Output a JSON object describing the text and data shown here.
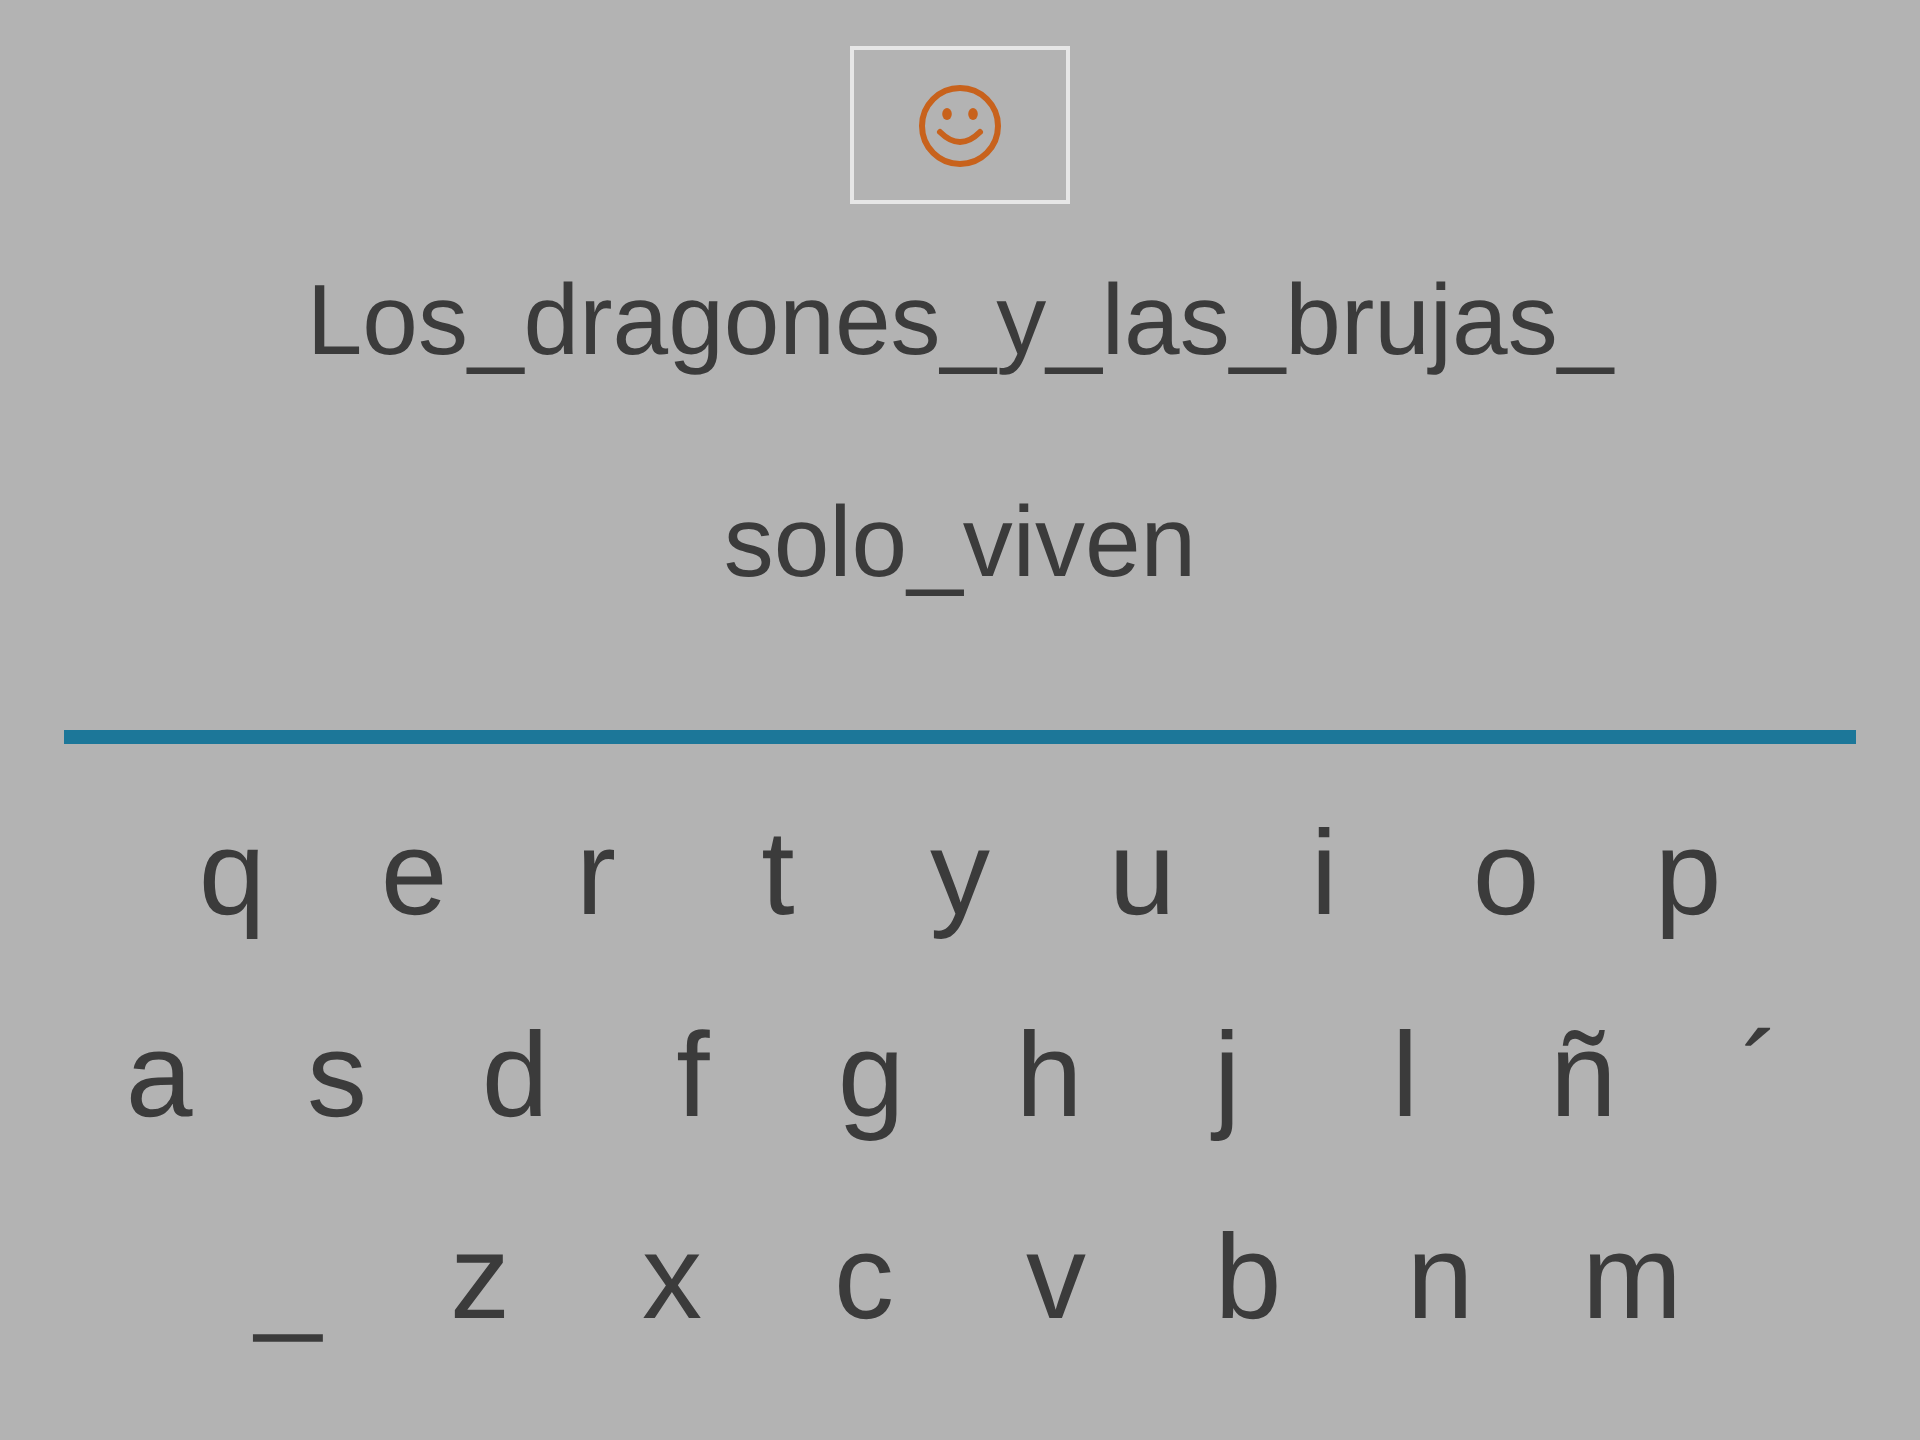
{
  "phrase_lines": [
    "Los_dragones_y_las_brujas_",
    "solo_viven"
  ],
  "keyboard": [
    [
      "q",
      "e",
      "r",
      "t",
      "y",
      "u",
      "i",
      "o",
      "p"
    ],
    [
      "a",
      "s",
      "d",
      "f",
      "g",
      "h",
      "j",
      "l",
      "ñ",
      "´"
    ],
    [
      "_",
      "z",
      "x",
      "c",
      "v",
      "b",
      "n",
      "m"
    ]
  ]
}
